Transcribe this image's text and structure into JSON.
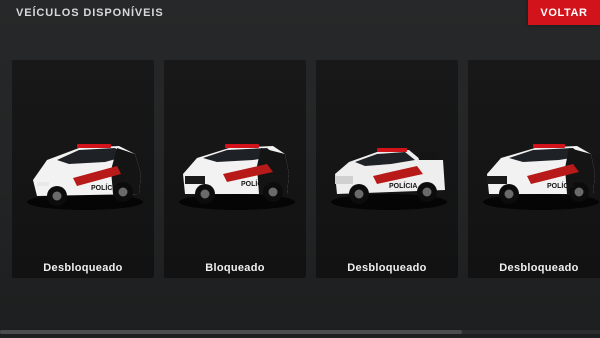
{
  "header": {
    "title": "VEÍCULOS DISPONÍVEIS",
    "back_label": "VOLTAR"
  },
  "vehicles": [
    {
      "model": "hatchback",
      "status": "Desbloqueado",
      "door_text": "POLÍCIA"
    },
    {
      "model": "compact-suv",
      "status": "Bloqueado",
      "door_text": "POLÍCIA"
    },
    {
      "model": "pickup",
      "status": "Desbloqueado",
      "door_text": "POLÍCIA"
    },
    {
      "model": "suv",
      "status": "Desbloqueado",
      "door_text": "POLÍCIA"
    }
  ],
  "colors": {
    "accent": "#d3131c",
    "livery_red": "#b81a1a",
    "livery_black": "#141414",
    "livery_white": "#f2f2f2"
  },
  "scroll": {
    "position": 0.0
  }
}
